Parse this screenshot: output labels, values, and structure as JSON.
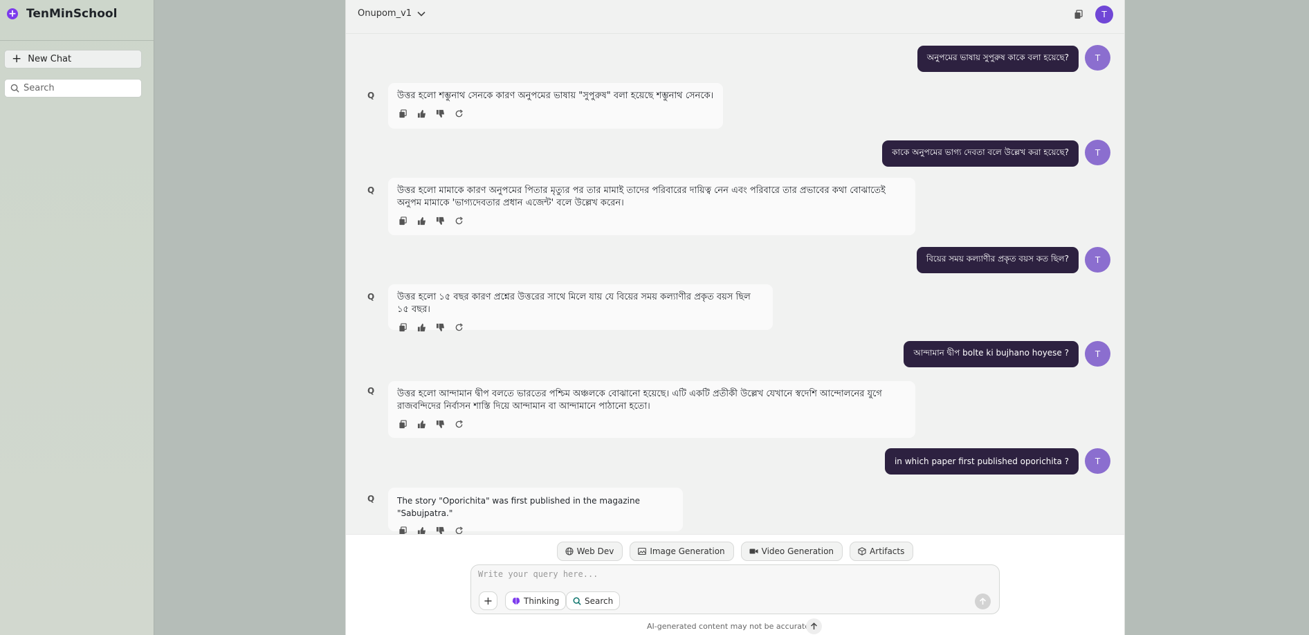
{
  "sidebar": {
    "brand": "TenMinSchool",
    "new_chat_label": "New Chat",
    "search_placeholder": "Search"
  },
  "header": {
    "model_name": "Onupom_v1",
    "avatar_initial": "T"
  },
  "messages": [
    {
      "role": "user",
      "text": "অনুপমের ভাষায় সুপুরুষ কাকে বলা হয়েছে?",
      "avatar": "T"
    },
    {
      "role": "assistant",
      "label": "Q",
      "text": "উত্তর হলো শম্ভুনাথ সেনকে কারণ অনুপমের ভাষায় \"সুপুরুষ\" বলা হয়েছে শম্ভুনাথ সেনকে।"
    },
    {
      "role": "user",
      "text": "কাকে অনুপমের ভাগ্য দেবতা বলে উল্লেখ করা হয়েছে?",
      "avatar": "T"
    },
    {
      "role": "assistant",
      "label": "Q",
      "text": "উত্তর হলো মামাকে কারণ অনুপমের পিতার মৃত্যুর পর তার মামাই তাদের পরিবারের দায়িত্ব নেন এবং পরিবারে তার প্রভাবের কথা বোঝাতেই অনুপম মামাকে 'ভাগ্যদেবতার প্রধান এজেন্ট' বলে উল্লেখ করেন।"
    },
    {
      "role": "user",
      "text": "বিয়ের সময় কল্যাণীর প্রকৃত বয়স কত ছিল?",
      "avatar": "T"
    },
    {
      "role": "assistant",
      "label": "Q",
      "text": "উত্তর হলো ১৫ বছর কারণ প্রশ্নের উত্তরের সাথে মিলে যায় যে বিয়ের সময় কল্যাণীর প্রকৃত বয়স ছিল ১৫ বছর।"
    },
    {
      "role": "user",
      "text": "আন্দামান দ্বীপ bolte ki bujhano hoyese ?",
      "avatar": "T"
    },
    {
      "role": "assistant",
      "label": "Q",
      "text": "উত্তর হলো আন্দামান দ্বীপ বলতে ভারতের পশ্চিম অঞ্চলকে বোঝানো হয়েছে। এটি একটি প্রতীকী উল্লেখ যেখানে স্বদেশি আন্দোলনের যুগে রাজবন্দিদের নির্বাসন শাস্তি দিয়ে আন্দামান বা আন্দামানে পাঠানো হতো।"
    },
    {
      "role": "user",
      "text": "in which paper first published oporichita ?",
      "avatar": "T"
    },
    {
      "role": "assistant",
      "label": "Q",
      "text": "The story \"Oporichita\" was first published in the magazine \"Sabujpatra.\""
    }
  ],
  "tools": {
    "web_dev": "Web Dev",
    "image_generation": "Image Generation",
    "video_generation": "Video Generation",
    "artifacts": "Artifacts"
  },
  "composer": {
    "placeholder": "Write your query here...",
    "thinking_label": "Thinking",
    "search_label": "Search"
  },
  "disclaimer": "AI-generated content may not be accurate.",
  "colors": {
    "accent": "#7c3aed",
    "user_bubble": "#2d2140",
    "user_avatar": "#8b6ecf"
  }
}
